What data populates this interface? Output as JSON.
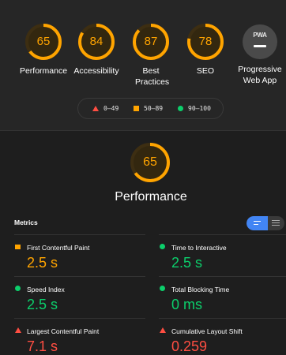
{
  "categories": [
    {
      "label": "Performance",
      "score": "65",
      "value": 65,
      "color": "#ffa400",
      "track": "#3d2e12",
      "fill": "#33270f"
    },
    {
      "label": "Accessibility",
      "score": "84",
      "value": 84,
      "color": "#ffa400",
      "track": "#3d2e12",
      "fill": "#33270f"
    },
    {
      "label": "Best Practices",
      "score": "87",
      "value": 87,
      "color": "#ffa400",
      "track": "#3d2e12",
      "fill": "#33270f"
    },
    {
      "label": "SEO",
      "score": "78",
      "value": 78,
      "color": "#ffa400",
      "track": "#3d2e12",
      "fill": "#33270f"
    }
  ],
  "pwa": {
    "label": "Progressive Web App",
    "badge_text": "PWA",
    "icon": "pwa-badge-icon"
  },
  "legend": {
    "fail": "0–49",
    "average": "50–89",
    "pass": "90–100"
  },
  "main": {
    "score": "65",
    "value": 65,
    "title": "Performance"
  },
  "metrics_label": "Metrics",
  "metrics": [
    {
      "title": "First Contentful Paint",
      "value": "2.5 s",
      "status": "average",
      "color": "#ffa400"
    },
    {
      "title": "Time to Interactive",
      "value": "2.5 s",
      "status": "pass",
      "color": "#0cce6b"
    },
    {
      "title": "Speed Index",
      "value": "2.5 s",
      "status": "pass",
      "color": "#0cce6b"
    },
    {
      "title": "Total Blocking Time",
      "value": "0 ms",
      "status": "pass",
      "color": "#0cce6b"
    },
    {
      "title": "Largest Contentful Paint",
      "value": "7.1 s",
      "status": "fail",
      "color": "#ff4e42"
    },
    {
      "title": "Cumulative Layout Shift",
      "value": "0.259",
      "status": "fail",
      "color": "#ff4e42"
    }
  ],
  "colors": {
    "pass": "#0cce6b",
    "average": "#ffa400",
    "fail": "#ff4e42",
    "accent": "#4285f4"
  }
}
